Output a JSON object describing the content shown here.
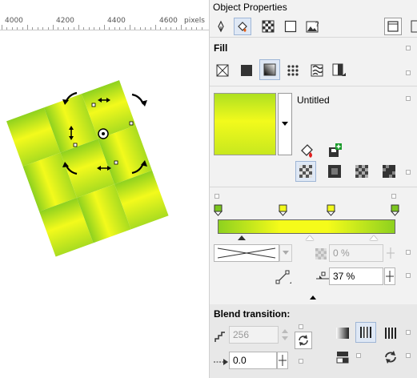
{
  "ruler": {
    "labels": [
      "4000",
      "4200",
      "4400",
      "4600",
      "pixels"
    ]
  },
  "panel": {
    "title": "Object Properties",
    "fill_section": {
      "title": "Fill",
      "fill_name": "Untitled"
    },
    "gradient": {
      "stop_colors": [
        "#7cc61e",
        "#f2f91c",
        "#f2f91c",
        "#7cc61e"
      ],
      "opacity_value": "0 %",
      "acceleration_value": "37 %"
    },
    "blend": {
      "title": "Blend transition:",
      "steps_value": "256",
      "offset_value": "0.0"
    }
  },
  "colors": {
    "accent_selection": "#dfe8f5",
    "gradient_green": "#8ed11f",
    "gradient_yellow": "#f5fb1a"
  }
}
